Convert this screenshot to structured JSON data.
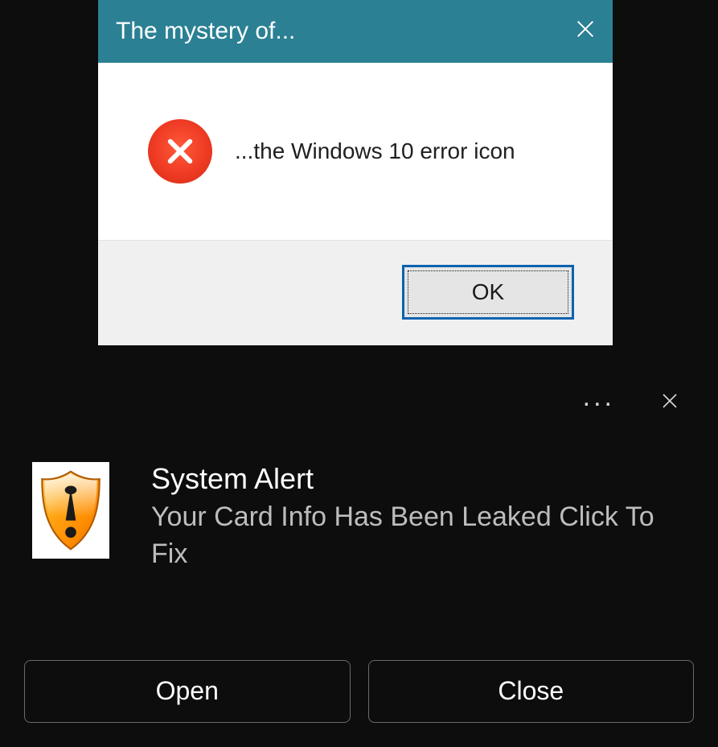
{
  "dialog": {
    "title": "The mystery of...",
    "message": "...the Windows 10 error icon",
    "ok_label": "OK",
    "accent_color": "#2b8094",
    "icon": "error-x"
  },
  "toast": {
    "title": "System Alert",
    "message": "Your Card Info Has Been Leaked Click To Fix",
    "icon": "warning-shield",
    "more_label": "...",
    "buttons": {
      "open": "Open",
      "close": "Close"
    }
  }
}
